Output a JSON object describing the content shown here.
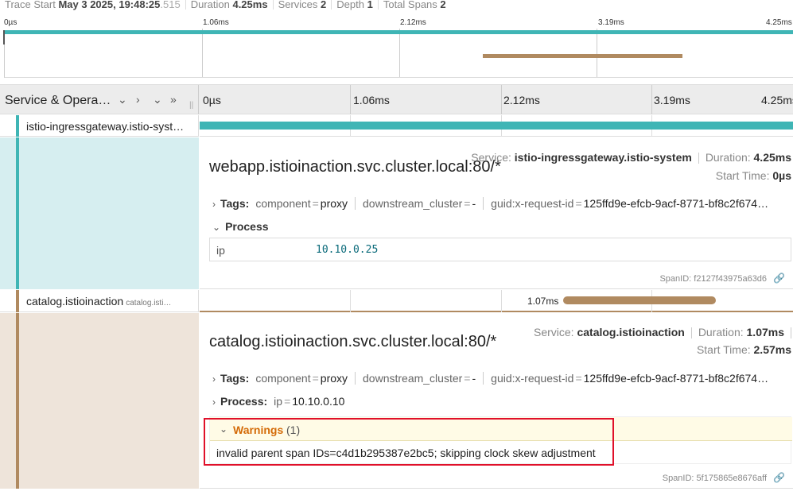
{
  "header": {
    "trace_start_label": "Trace Start",
    "trace_start_value": "May 3 2025, 19:48:25",
    "trace_start_ms": ".515",
    "duration_label": "Duration",
    "duration_value": "4.25ms",
    "services_label": "Services",
    "services_value": "2",
    "depth_label": "Depth",
    "depth_value": "1",
    "total_spans_label": "Total Spans",
    "total_spans_value": "2"
  },
  "minimap": {
    "ticks": [
      "0µs",
      "1.06ms",
      "2.12ms",
      "3.19ms",
      "4.25ms"
    ]
  },
  "columns": {
    "service_label": "Service & Opera…",
    "ticks": [
      "0µs",
      "1.06ms",
      "2.12ms",
      "3.19ms",
      "4.25ms"
    ]
  },
  "spans": [
    {
      "service_short": "istio-ingressgateway.istio-syst…",
      "operation": "webapp.istioinaction.svc.cluster.local:80/*",
      "service_label": "Service:",
      "service": "istio-ingressgateway.istio-system",
      "duration_label": "Duration:",
      "duration": "4.25ms",
      "start_label": "Start Time:",
      "start": "0µs",
      "tags_label": "Tags:",
      "tags": [
        {
          "k": "component",
          "v": "proxy"
        },
        {
          "k": "downstream_cluster",
          "v": "-"
        },
        {
          "k": "guid:x-request-id",
          "v": "125ffd9e-efcb-9acf-8771-bf8c2f674…"
        }
      ],
      "process_label": "Process",
      "process": [
        {
          "k": "ip",
          "v": "10.10.0.25"
        }
      ],
      "spanid_label": "SpanID:",
      "spanid": "f2127f43975a63d6",
      "color": "#3fb5b5"
    },
    {
      "service_short": "catalog.istioinaction",
      "op_short": "catalog.isti…",
      "bar_label": "1.07ms",
      "operation": "catalog.istioinaction.svc.cluster.local:80/*",
      "service_label": "Service:",
      "service": "catalog.istioinaction",
      "duration_label": "Duration:",
      "duration": "1.07ms",
      "start_label": "Start Time:",
      "start": "2.57ms",
      "tags_label": "Tags:",
      "tags": [
        {
          "k": "component",
          "v": "proxy"
        },
        {
          "k": "downstream_cluster",
          "v": "-"
        },
        {
          "k": "guid:x-request-id",
          "v": "125ffd9e-efcb-9acf-8771-bf8c2f674…"
        }
      ],
      "process_label": "Process:",
      "process_inline": {
        "k": "ip",
        "v": "10.10.0.10"
      },
      "warnings_label": "Warnings",
      "warnings_count": "(1)",
      "warning_text": "invalid parent span IDs=c4d1b295387e2bc5; skipping clock skew adjustment",
      "spanid_label": "SpanID:",
      "spanid": "5f175865e8676aff",
      "color": "#b08a60"
    }
  ]
}
